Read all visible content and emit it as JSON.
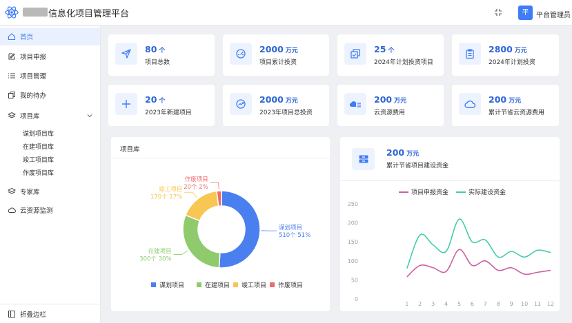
{
  "header": {
    "app_title": "信息化项目管理平台",
    "avatar_text": "平",
    "user_name": "平台管理员"
  },
  "sidebar": {
    "items": [
      {
        "label": "首页",
        "icon": "home-icon",
        "active": true
      },
      {
        "label": "项目申报",
        "icon": "edit-icon"
      },
      {
        "label": "项目管理",
        "icon": "list-icon"
      },
      {
        "label": "我的待办",
        "icon": "copy-icon"
      },
      {
        "label": "项目库",
        "icon": "layers-icon"
      }
    ],
    "sub_items": [
      "谋划项目库",
      "在建项目库",
      "竣工项目库",
      "作废项目库"
    ],
    "items_after": [
      {
        "label": "专家库",
        "icon": "layers-icon"
      },
      {
        "label": "云资源监测",
        "icon": "cloud-icon"
      }
    ],
    "collapse_label": "折叠边栏"
  },
  "stats": [
    {
      "value": "80",
      "unit": "个",
      "label": "项目总数",
      "icon": "send-icon"
    },
    {
      "value": "2000",
      "unit": "万元",
      "label": "项目累计投资",
      "icon": "gauge-icon"
    },
    {
      "value": "25",
      "unit": "个",
      "label": "2024年计划投资项目",
      "icon": "copy-check-icon"
    },
    {
      "value": "2800",
      "unit": "万元",
      "label": "2024年计划投资",
      "icon": "clipboard-icon"
    },
    {
      "value": "20",
      "unit": "个",
      "label": "2023年新建项目",
      "icon": "plus-icon"
    },
    {
      "value": "2000",
      "unit": "万元",
      "label": "2023年项目总投资",
      "icon": "trend-icon"
    },
    {
      "value": "200",
      "unit": "万元",
      "label": "云资源费用",
      "icon": "cloud-list-icon"
    },
    {
      "value": "200",
      "unit": "万元",
      "label": "累计节省云资源费用",
      "icon": "cloud-outline-icon"
    }
  ],
  "donut_panel": {
    "title": "项目库"
  },
  "line_panel": {
    "value": "200",
    "unit": "万元",
    "label": "累计节省项目建设资金",
    "icon": "server-icon"
  },
  "chart_data": [
    {
      "type": "pie",
      "categories": [
        "谋划项目",
        "在建项目",
        "竣工项目",
        "作废项目"
      ],
      "values": [
        510,
        300,
        170,
        20
      ],
      "value_labels": [
        "510个  51%",
        "300个  30%",
        "170个  17%",
        "20个  2%"
      ],
      "colors": [
        "#4a7ff0",
        "#8fcb6c",
        "#f8c652",
        "#ef6b6b"
      ],
      "legend": "bottom"
    },
    {
      "type": "line",
      "x": [
        1,
        2,
        3,
        4,
        5,
        6,
        7,
        8,
        9,
        10,
        11,
        12
      ],
      "series": [
        {
          "name": "项目申报资金",
          "color": "#cc5fa3",
          "values": [
            58,
            88,
            82,
            72,
            130,
            88,
            100,
            75,
            82,
            65,
            70,
            75
          ]
        },
        {
          "name": "实际建设资金",
          "color": "#44ccaa",
          "values": [
            80,
            168,
            142,
            125,
            210,
            150,
            155,
            110,
            125,
            110,
            128,
            122
          ]
        }
      ],
      "ylim": [
        0,
        250
      ],
      "yticks": [
        0,
        50,
        100,
        150,
        200,
        250
      ],
      "legend": "top",
      "grid": false
    }
  ]
}
